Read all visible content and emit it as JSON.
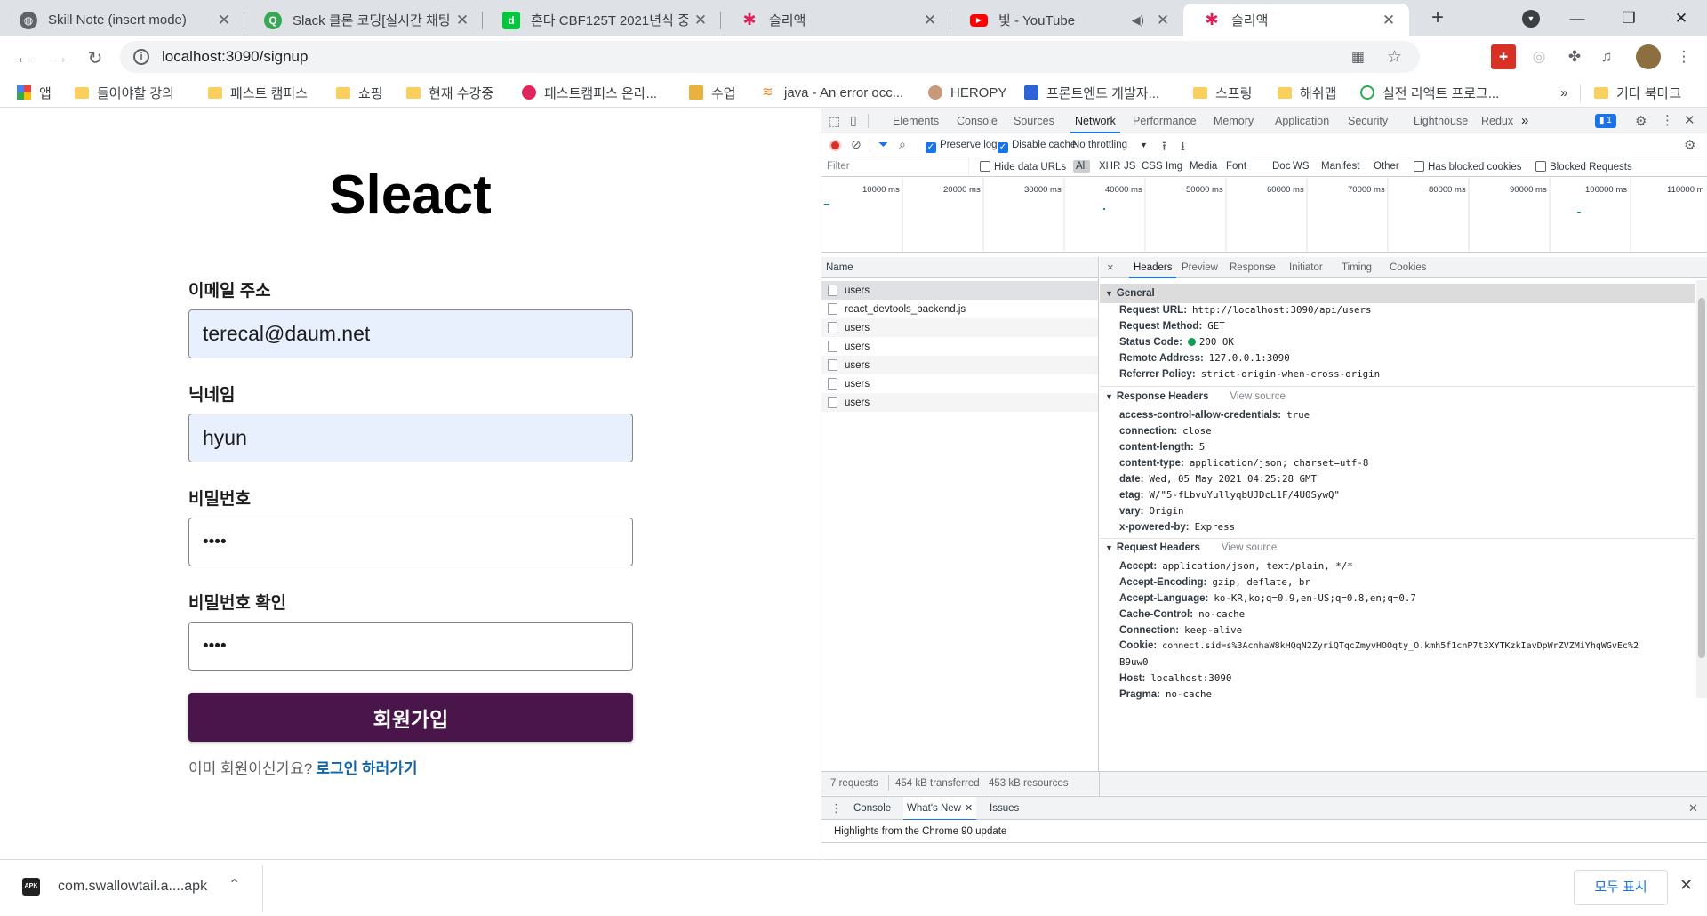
{
  "tabs": [
    {
      "title": "Skill Note (insert mode)",
      "icon": "globe-icon",
      "color": "#5f6368"
    },
    {
      "title": "Slack 클론 코딩[실시간 채팅",
      "icon": "search-icon",
      "color": "#34a853"
    },
    {
      "title": "혼다 CBF125T 2021년식 중",
      "icon": "d-icon",
      "color": "#00c73c"
    },
    {
      "title": "슬리액",
      "icon": "slack-icon",
      "color": "#e01e5a"
    },
    {
      "title": "빛 - YouTube",
      "icon": "youtube-icon",
      "color": "#ff0000"
    },
    {
      "title": "슬리액",
      "icon": "slack-icon",
      "color": "#e01e5a"
    }
  ],
  "address_bar": {
    "url": "localhost:3090/signup"
  },
  "bookmarks": [
    {
      "label": "앱",
      "icon": "apps-icon"
    },
    {
      "label": "들어야할 강의",
      "icon": "folder-icon"
    },
    {
      "label": "패스트 캠퍼스",
      "icon": "folder-icon"
    },
    {
      "label": "쇼핑",
      "icon": "folder-icon"
    },
    {
      "label": "현재 수강중",
      "icon": "folder-icon"
    },
    {
      "label": "패스트캠퍼스 온라...",
      "icon": "fastcampus-icon"
    },
    {
      "label": "수업",
      "icon": "image-icon"
    },
    {
      "label": "java - An error occ...",
      "icon": "stackoverflow-icon"
    },
    {
      "label": "HEROPY",
      "icon": "avatar-icon"
    },
    {
      "label": "프론트엔드 개발자...",
      "icon": "person-icon"
    },
    {
      "label": "스프링",
      "icon": "folder-icon"
    },
    {
      "label": "해쉬맵",
      "icon": "folder-icon"
    },
    {
      "label": "실전 리액트 프로그...",
      "icon": "search-icon"
    },
    {
      "label": "»",
      "icon": ""
    },
    {
      "label": "기타 북마크",
      "icon": "folder-icon"
    }
  ],
  "signup": {
    "logo": "Sleact",
    "email_label": "이메일 주소",
    "email_value": "terecal@daum.net",
    "nickname_label": "닉네임",
    "nickname_value": "hyun",
    "password_label": "비밀번호",
    "password_value": "••••",
    "password_check_label": "비밀번호 확인",
    "password_check_value": "••••",
    "submit_label": "회원가입",
    "already_member": "이미 회원이신가요?",
    "login_link": "로그인 하러가기"
  },
  "devtools": {
    "tabs": [
      "Elements",
      "Console",
      "Sources",
      "Network",
      "Performance",
      "Memory",
      "Application",
      "Security",
      "Lighthouse",
      "Redux"
    ],
    "active_tab": "Network",
    "more_tabs": "»",
    "issues_badge": "1",
    "toolbar": {
      "preserve_log": "Preserve log",
      "disable_cache": "Disable cache",
      "throttling": "No throttling"
    },
    "filter_bar": {
      "placeholder": "Filter",
      "hide_data_urls": "Hide data URLs",
      "types": [
        "All",
        "XHR",
        "JS",
        "CSS",
        "Img",
        "Media",
        "Font",
        "Doc",
        "WS",
        "Manifest",
        "Other"
      ],
      "has_blocked_cookies": "Has blocked cookies",
      "blocked_requests": "Blocked Requests"
    },
    "timeline_ticks": [
      "10000 ms",
      "20000 ms",
      "30000 ms",
      "40000 ms",
      "50000 ms",
      "60000 ms",
      "70000 ms",
      "80000 ms",
      "90000 ms",
      "100000 ms",
      "110000 m"
    ],
    "name_header": "Name",
    "requests": [
      "users",
      "react_devtools_backend.js",
      "users",
      "users",
      "users",
      "users",
      "users"
    ],
    "detail_tabs": [
      "Headers",
      "Preview",
      "Response",
      "Initiator",
      "Timing",
      "Cookies"
    ],
    "close_x": "×",
    "general": {
      "title": "General",
      "rows": [
        {
          "k": "Request URL:",
          "v": "http://localhost:3090/api/users"
        },
        {
          "k": "Request Method:",
          "v": "GET"
        },
        {
          "k": "Status Code:",
          "v": "200 OK"
        },
        {
          "k": "Remote Address:",
          "v": "127.0.0.1:3090"
        },
        {
          "k": "Referrer Policy:",
          "v": "strict-origin-when-cross-origin"
        }
      ]
    },
    "response_headers": {
      "title": "Response Headers",
      "view_source": "View source",
      "rows": [
        {
          "k": "access-control-allow-credentials:",
          "v": "true"
        },
        {
          "k": "connection:",
          "v": "close"
        },
        {
          "k": "content-length:",
          "v": "5"
        },
        {
          "k": "content-type:",
          "v": "application/json; charset=utf-8"
        },
        {
          "k": "date:",
          "v": "Wed, 05 May 2021 04:25:28 GMT"
        },
        {
          "k": "etag:",
          "v": "W/\"5-fLbvuYullyqbUJDcL1F/4U0SywQ\""
        },
        {
          "k": "vary:",
          "v": "Origin"
        },
        {
          "k": "x-powered-by:",
          "v": "Express"
        }
      ]
    },
    "request_headers": {
      "title": "Request Headers",
      "view_source": "View source",
      "rows": [
        {
          "k": "Accept:",
          "v": "application/json, text/plain, */*"
        },
        {
          "k": "Accept-Encoding:",
          "v": "gzip, deflate, br"
        },
        {
          "k": "Accept-Language:",
          "v": "ko-KR,ko;q=0.9,en-US;q=0.8,en;q=0.7"
        },
        {
          "k": "Cache-Control:",
          "v": "no-cache"
        },
        {
          "k": "Connection:",
          "v": "keep-alive"
        },
        {
          "k": "Cookie:",
          "v": "connect.sid=s%3AcnhaW8kHQqN2ZyriQTqcZmyvHOOqty_O.kmh5f1cnP7t3XYTKzkIavDpWrZVZMiYhqWGvEc%2"
        },
        {
          "k": "",
          "v": "B9uw0"
        },
        {
          "k": "Host:",
          "v": "localhost:3090"
        },
        {
          "k": "Pragma:",
          "v": "no-cache"
        }
      ]
    },
    "summary": {
      "requests": "7 requests",
      "transferred": "454 kB transferred",
      "resources": "453 kB resources"
    },
    "drawer_tabs": [
      "Console",
      "What's New",
      "Issues"
    ],
    "drawer_active": "What's New",
    "drawer_message": "Highlights from the Chrome 90 update"
  },
  "downloads": {
    "file_name": "com.swallowtail.a....apk",
    "show_all": "모두 표시"
  },
  "colors": {
    "slack_purple": "#4a154b",
    "autofill_bg": "#e8f0fe",
    "link_blue": "#1264a3",
    "devtools_accent": "#1a73e8",
    "status_green": "#0f9d58"
  }
}
